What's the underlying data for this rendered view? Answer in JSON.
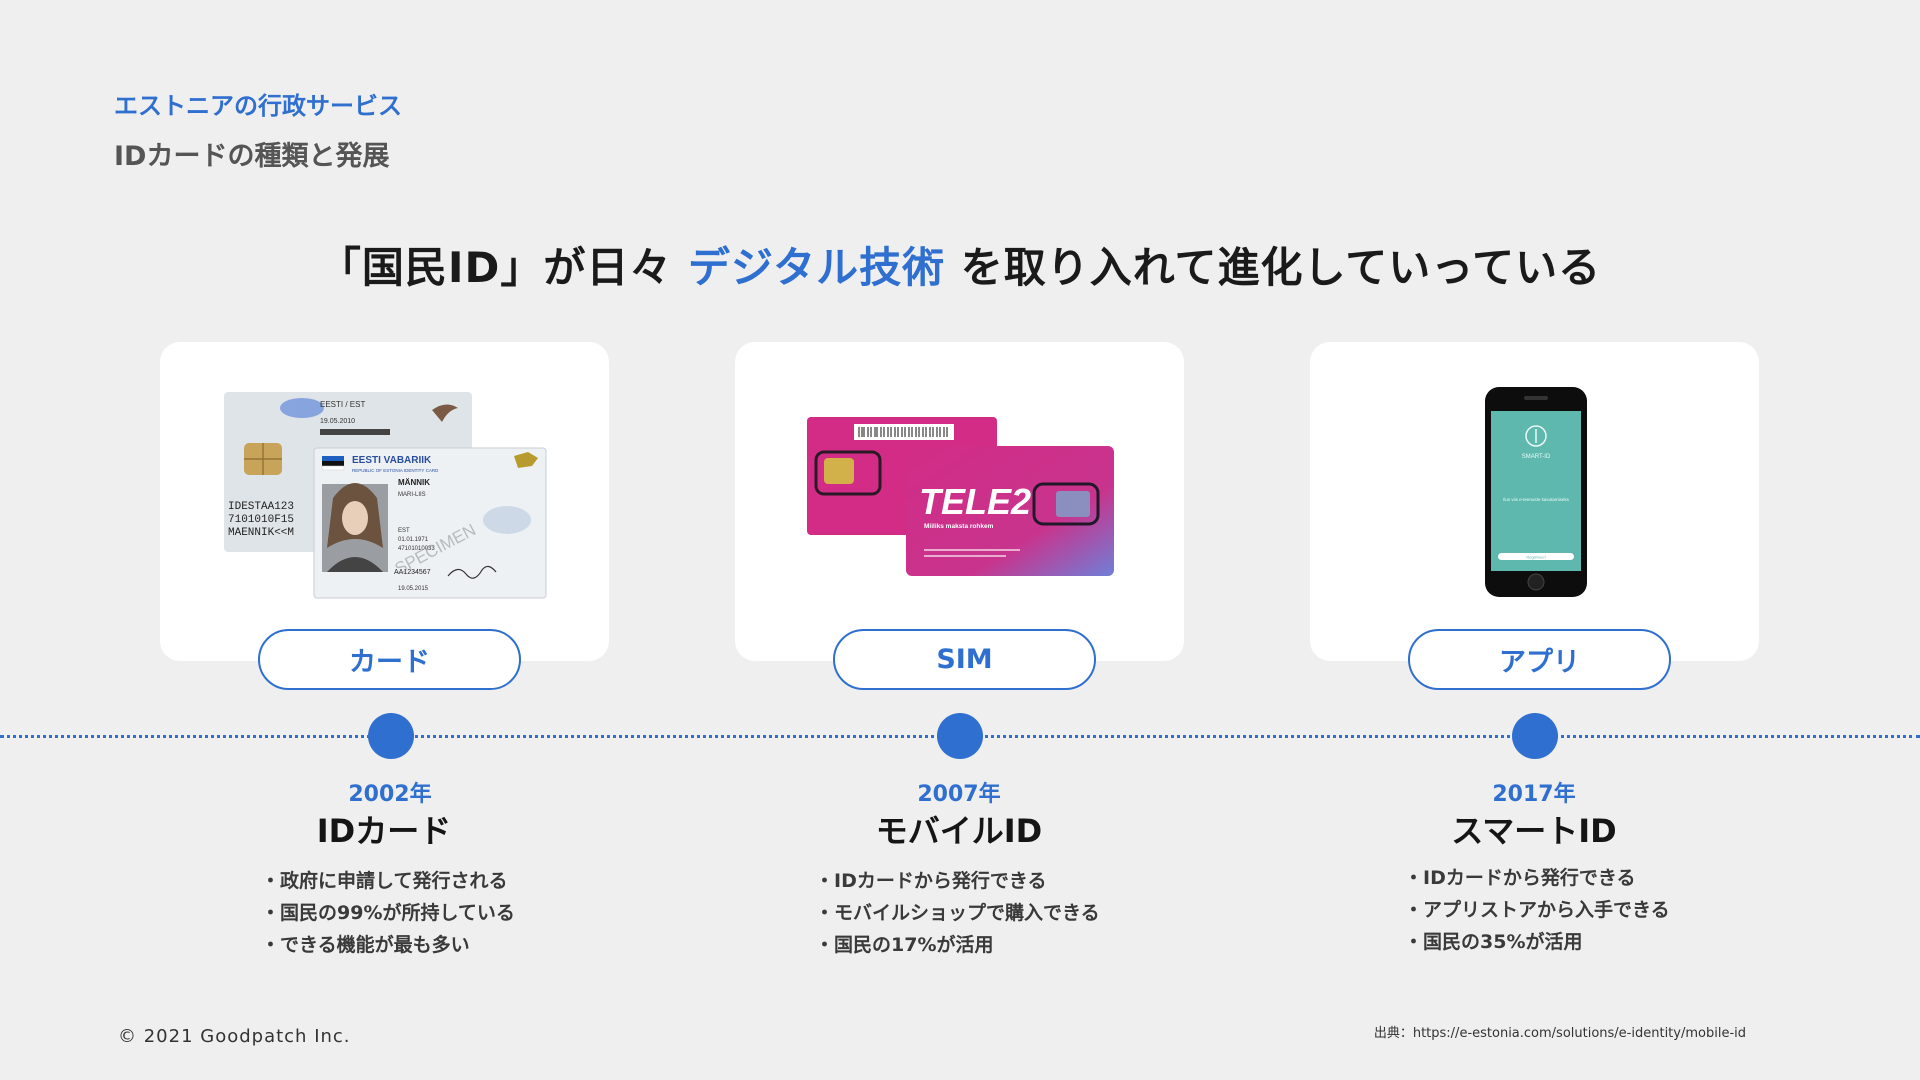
{
  "header": {
    "section": "エストニアの行政サービス",
    "subtitle": "IDカードの種類と発展"
  },
  "headline": {
    "before": "「国民ID」が日々 ",
    "highlight": "デジタル技術",
    "after": " を取り入れて進化していっている"
  },
  "colors": {
    "accent": "#2f6fcf",
    "background": "#efeff0",
    "sim_pink": "#d22c86"
  },
  "items": [
    {
      "image": "estonian-id-card",
      "label": "カード",
      "year": "2002年",
      "title": "IDカード",
      "bullets": [
        "政府に申請して発行される",
        "国民の99%が所持している",
        "できる機能が最も多い"
      ]
    },
    {
      "image": "tele2-sim-card",
      "label": "SIM",
      "year": "2007年",
      "title": "モバイルID",
      "bullets": [
        "IDカードから発行できる",
        "モバイルショップで購入できる",
        "国民の17%が活用"
      ]
    },
    {
      "image": "smart-id-phone",
      "label": "アプリ",
      "year": "2017年",
      "title": "スマートID",
      "bullets": [
        "IDカードから発行できる",
        "アプリストアから入手できる",
        "国民の35%が活用"
      ]
    }
  ],
  "images": {
    "card_back_header": "EESTI / EST",
    "card_back_date": "19.05.2010",
    "card_mrz": [
      "IDESTAA123",
      "7101010F15",
      "MAENNIK<<M"
    ],
    "card_front_header": "EESTI VABARIIK",
    "card_front_sub": "REPUBLIC OF ESTONIA IDENTITY CARD",
    "card_surname": "MÄNNIK",
    "card_given": "MARI-LIIS",
    "card_specimen": "SPECIMEN",
    "card_number": "AA1234567",
    "card_expiry": "19.05.2015",
    "card_nat": "EST",
    "card_dob": "01.01.1971",
    "card_code": "47101010033",
    "sim_brand": "TELE2",
    "sim_tagline": "Miiliks maksta rohkem",
    "phone_app": "SMART-ID",
    "phone_text": "Ilus viis e-teenuste kasutamiseks",
    "phone_button": "Registreeri"
  },
  "footer": {
    "copyright": "© 2021 Goodpatch Inc.",
    "source": "出典：https://e-estonia.com/solutions/e-identity/mobile-id"
  }
}
